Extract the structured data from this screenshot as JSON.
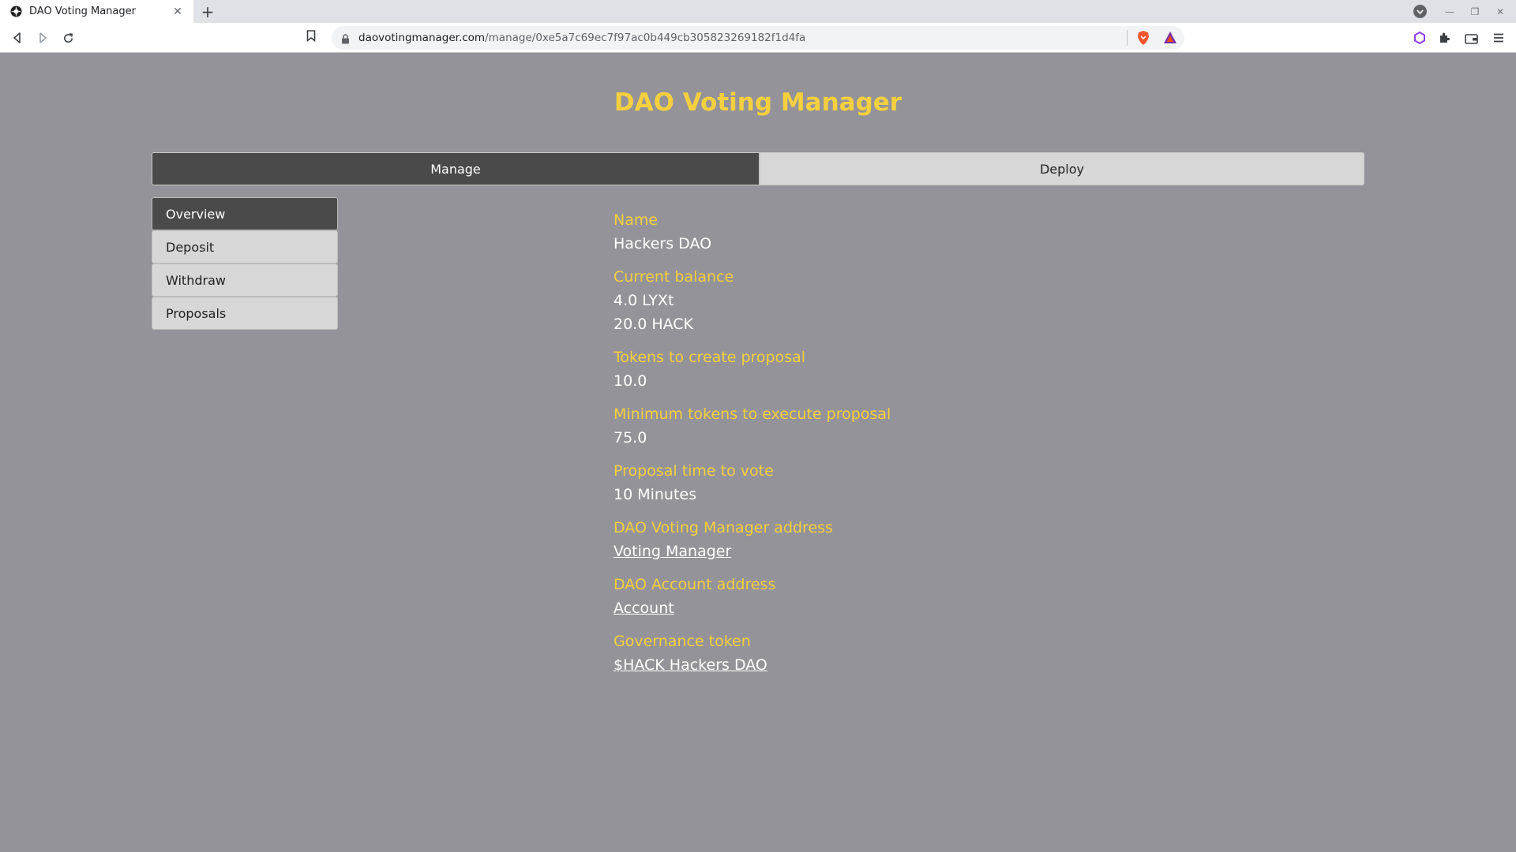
{
  "browser": {
    "tab_title": "DAO Voting Manager",
    "url_host": "daovotingmanager.com",
    "url_path": "/manage/0xe5a7c69ec7f97ac0b449cb305823269182f1d4fa"
  },
  "page": {
    "title": "DAO Voting Manager",
    "main_tabs": [
      {
        "label": "Manage",
        "active": true
      },
      {
        "label": "Deploy",
        "active": false
      }
    ],
    "side_menu": [
      {
        "label": "Overview",
        "active": true
      },
      {
        "label": "Deposit",
        "active": false
      },
      {
        "label": "Withdraw",
        "active": false
      },
      {
        "label": "Proposals",
        "active": false
      }
    ],
    "fields": {
      "name": {
        "label": "Name",
        "value": "Hackers DAO"
      },
      "balance": {
        "label": "Current balance",
        "values": [
          "4.0 LYXt",
          "20.0 HACK"
        ]
      },
      "create_tokens": {
        "label": "Tokens to create proposal",
        "value": "10.0"
      },
      "execute_tokens": {
        "label": "Minimum tokens to execute proposal",
        "value": "75.0"
      },
      "vote_time": {
        "label": "Proposal time to vote",
        "value": "10 Minutes"
      },
      "manager_address": {
        "label": "DAO Voting Manager address",
        "link": "Voting Manager"
      },
      "account_address": {
        "label": "DAO Account address",
        "link": "Account"
      },
      "governance_token": {
        "label": "Governance token",
        "link": "$HACK Hackers DAO"
      }
    }
  },
  "colors": {
    "background": "#949399",
    "accent": "#f4d03f",
    "active_tab": "#4a4a4a",
    "inactive_tab": "#d7d7d7"
  }
}
